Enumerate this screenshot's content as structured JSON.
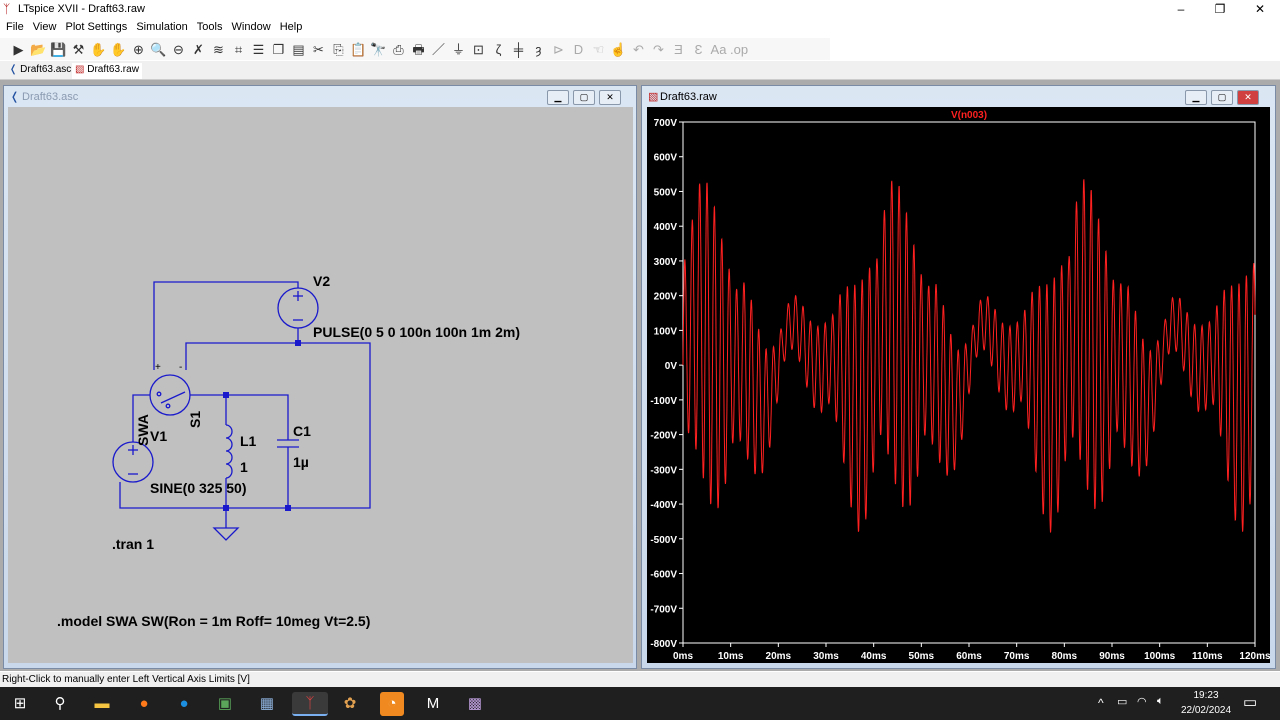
{
  "app": {
    "title": "LTspice XVII - Draft63.raw"
  },
  "menu": [
    "File",
    "View",
    "Plot Settings",
    "Simulation",
    "Tools",
    "Window",
    "Help"
  ],
  "toolbar_icons": [
    "run",
    "open",
    "save",
    "control-panel",
    "halt",
    "pan",
    "zoom-in",
    "zoom-area",
    "zoom-out",
    "zoom-cancel",
    "autorange",
    "mark-data",
    "tile-horizontal",
    "cascade",
    "tile",
    "cut",
    "copy",
    "paste",
    "find",
    "print-setup",
    "print",
    "wire",
    "ground",
    "label",
    "resistor",
    "capacitor",
    "inductor",
    "diode",
    "component",
    "move",
    "drag",
    "undo",
    "redo",
    "rotate",
    "mirror",
    "text",
    "spice-directive"
  ],
  "tabs": [
    {
      "label": "Draft63.asc"
    },
    {
      "label": "Draft63.raw"
    }
  ],
  "schematic": {
    "title": "Draft63.asc",
    "labels": {
      "v2": "V2",
      "v2_value": "PULSE(0 5 0 100n 100n 1m 2m)",
      "v1": "V1",
      "v1_value": "SINE(0 325 50)",
      "s1": "S1",
      "s1_model": "SWA",
      "l1": "L1",
      "l1_value": "1",
      "c1": "C1",
      "c1_value": "1µ",
      "plus": "+",
      "minus": "-"
    },
    "directives": [
      ".tran 1",
      ".model SWA SW(Ron = 1m Roff= 10meg Vt=2.5)"
    ]
  },
  "waveform": {
    "title": "Draft63.raw",
    "chart_data": {
      "type": "line",
      "series": [
        {
          "name": "V(n003)",
          "color": "#ff2020"
        }
      ],
      "yticks": [
        "700V",
        "600V",
        "500V",
        "400V",
        "300V",
        "200V",
        "100V",
        "0V",
        "-100V",
        "-200V",
        "-300V",
        "-400V",
        "-500V",
        "-600V",
        "-700V",
        "-800V"
      ],
      "xticks": [
        "0ms",
        "10ms",
        "20ms",
        "30ms",
        "40ms",
        "50ms",
        "60ms",
        "70ms",
        "80ms",
        "90ms",
        "100ms",
        "110ms",
        "120ms"
      ],
      "ylim": [
        -800,
        700
      ],
      "xlim": [
        0,
        120
      ],
      "grid": false
    }
  },
  "status": {
    "text": "Right-Click to manually enter Left Vertical Axis Limits [V]"
  },
  "taskbar": {
    "time": "19:23",
    "date": "22/02/2024"
  },
  "colors": {
    "wire": "#1a1acc",
    "trace": "#ff2020",
    "plot_bg": "#000000",
    "schematic_bg": "#c0c0c0"
  }
}
